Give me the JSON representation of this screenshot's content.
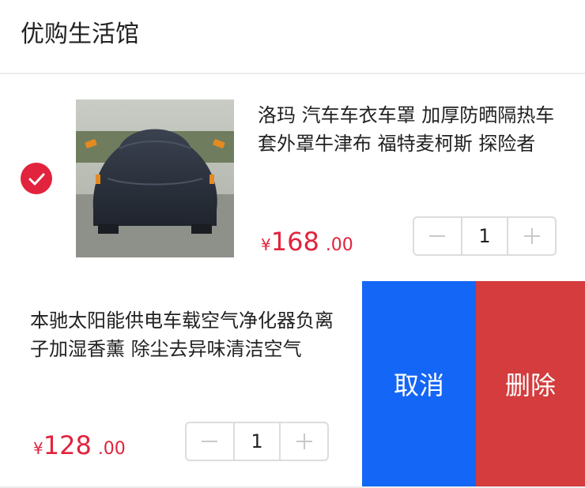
{
  "shop": {
    "name": "优购生活馆"
  },
  "items": [
    {
      "checked": true,
      "image": "car-cover-photo",
      "title": "洛玛 汽车车衣车罩 加厚防晒隔热车套外罩牛津布 福特麦柯斯 探险者",
      "price_symbol": "¥",
      "price_int": "168",
      "price_dec": ".00",
      "quantity": "1",
      "minus_icon": "minus-icon",
      "plus_icon": "plus-icon"
    },
    {
      "title": "本驰太阳能供电车载空气净化器负离子加湿香薰 除尘去异味清洁空气",
      "price_symbol": "¥",
      "price_int": "128",
      "price_dec": ".00",
      "quantity": "1",
      "actions": {
        "cancel_label": "取消",
        "delete_label": "删除"
      }
    }
  ],
  "colors": {
    "accent_red": "#e2233d",
    "cancel_blue": "#1466f6",
    "delete_red": "#d43c3d"
  }
}
